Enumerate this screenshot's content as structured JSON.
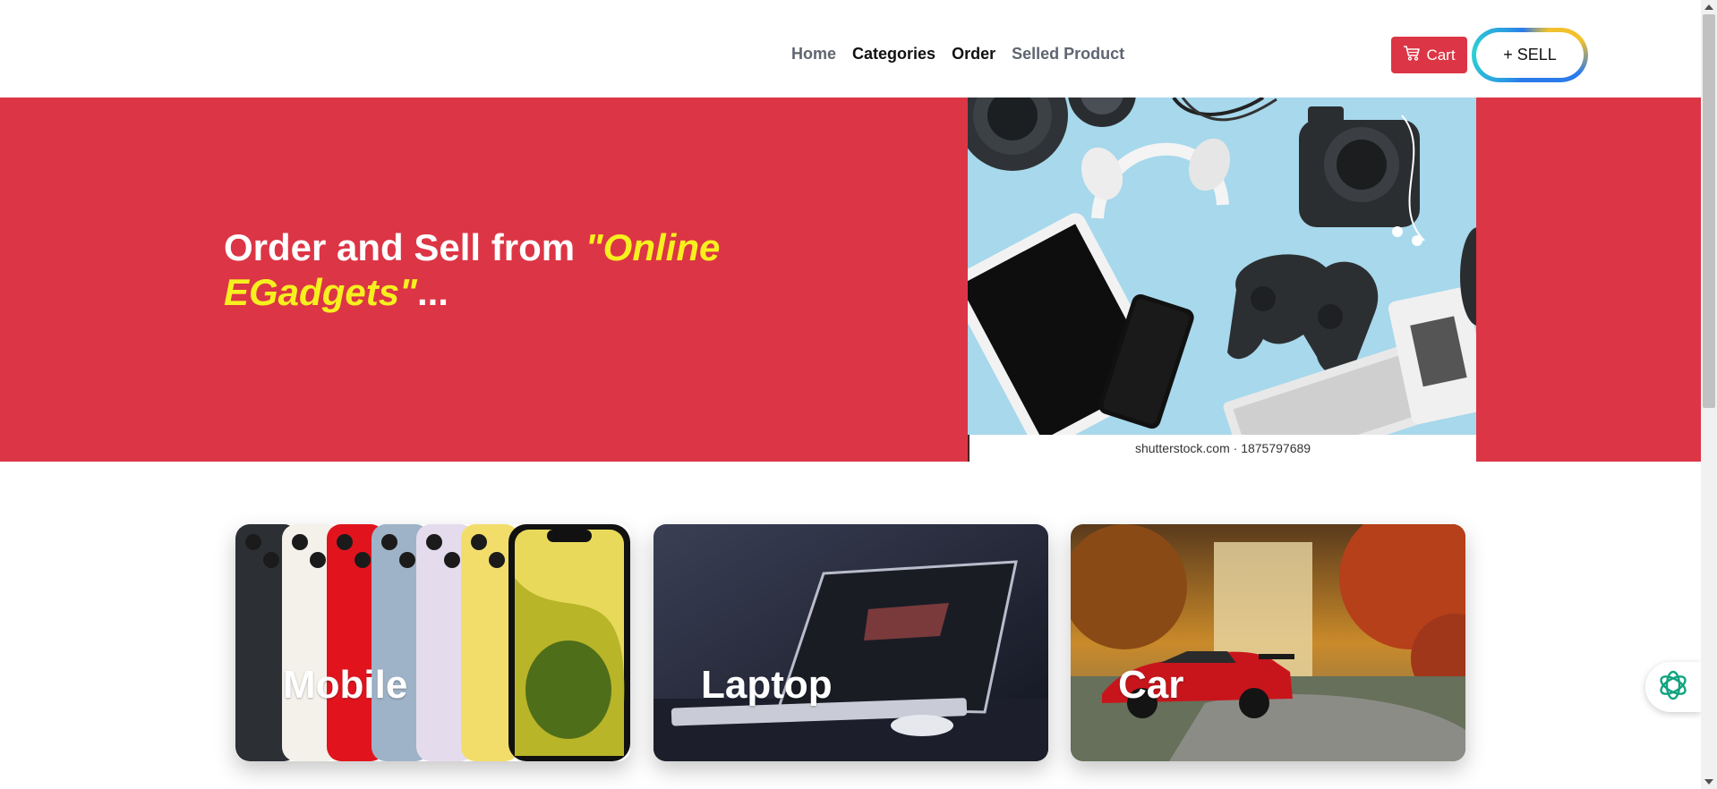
{
  "nav": {
    "items": [
      {
        "label": "Home",
        "style": "muted"
      },
      {
        "label": "Categories",
        "style": "strong"
      },
      {
        "label": "Order",
        "style": "strong"
      },
      {
        "label": "Selled Product",
        "style": "muted"
      }
    ]
  },
  "header": {
    "cart_label": "Cart",
    "cart_icon": "cart-icon",
    "sell_label": "+ SELL"
  },
  "hero": {
    "title_prefix": "Order and Sell from ",
    "title_highlight": "\"Online EGadgets\"",
    "title_suffix": "...",
    "image_icon": "gadgets-photo",
    "image_credit": "shutterstock.com · 1875797689"
  },
  "categories": [
    {
      "label": "Mobile",
      "image": "iphone-lineup-photo"
    },
    {
      "label": "Laptop",
      "image": "laptop-desk-photo"
    },
    {
      "label": "Car",
      "image": "red-sports-car-photo"
    }
  ],
  "assistant": {
    "icon": "openai-assistant-icon"
  },
  "colors": {
    "brand_red": "#dc3545",
    "highlight_yellow": "#f7f01f",
    "assistant_green": "#10a37f"
  }
}
